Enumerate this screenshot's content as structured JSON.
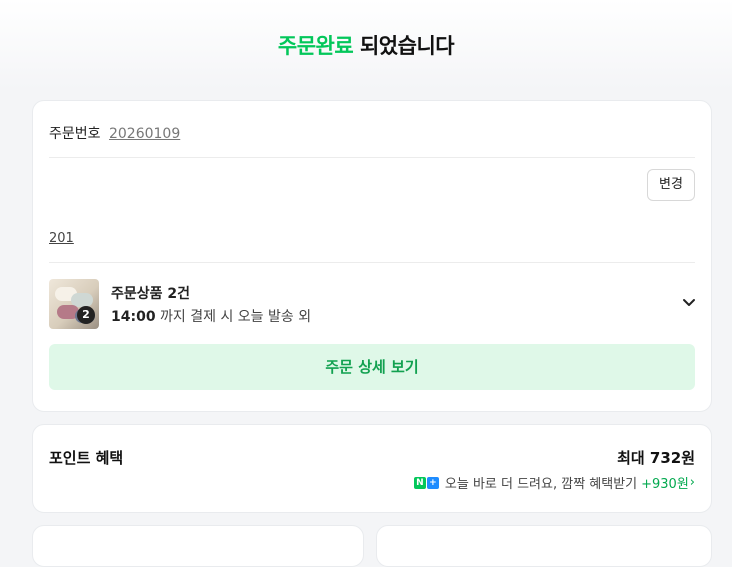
{
  "header": {
    "title_accent": "주문완료",
    "title_rest": " 되었습니다"
  },
  "order": {
    "number_label": "주문번호",
    "number_value": "20260109",
    "address_change_label": "변경",
    "postal_prefix": "201"
  },
  "products": {
    "title": "주문상품 2건",
    "thumb_count": "2",
    "shipping_time": "14:00",
    "shipping_text": " 까지 결제 시 오늘 발송 외",
    "detail_button_label": "주문 상세 보기"
  },
  "points": {
    "title": "포인트 혜택",
    "max_label": "최대 732원",
    "icon_n": "N",
    "icon_p": "+",
    "promo_text": "오늘 바로 더 드려요, 깜짝 혜택받기",
    "promo_amount": "+930원",
    "promo_chevron": "›"
  },
  "colors": {
    "brand_green": "#03c75a",
    "button_bg": "#dff8e8",
    "button_text": "#12a150",
    "npay_blue": "#1e8cff"
  }
}
